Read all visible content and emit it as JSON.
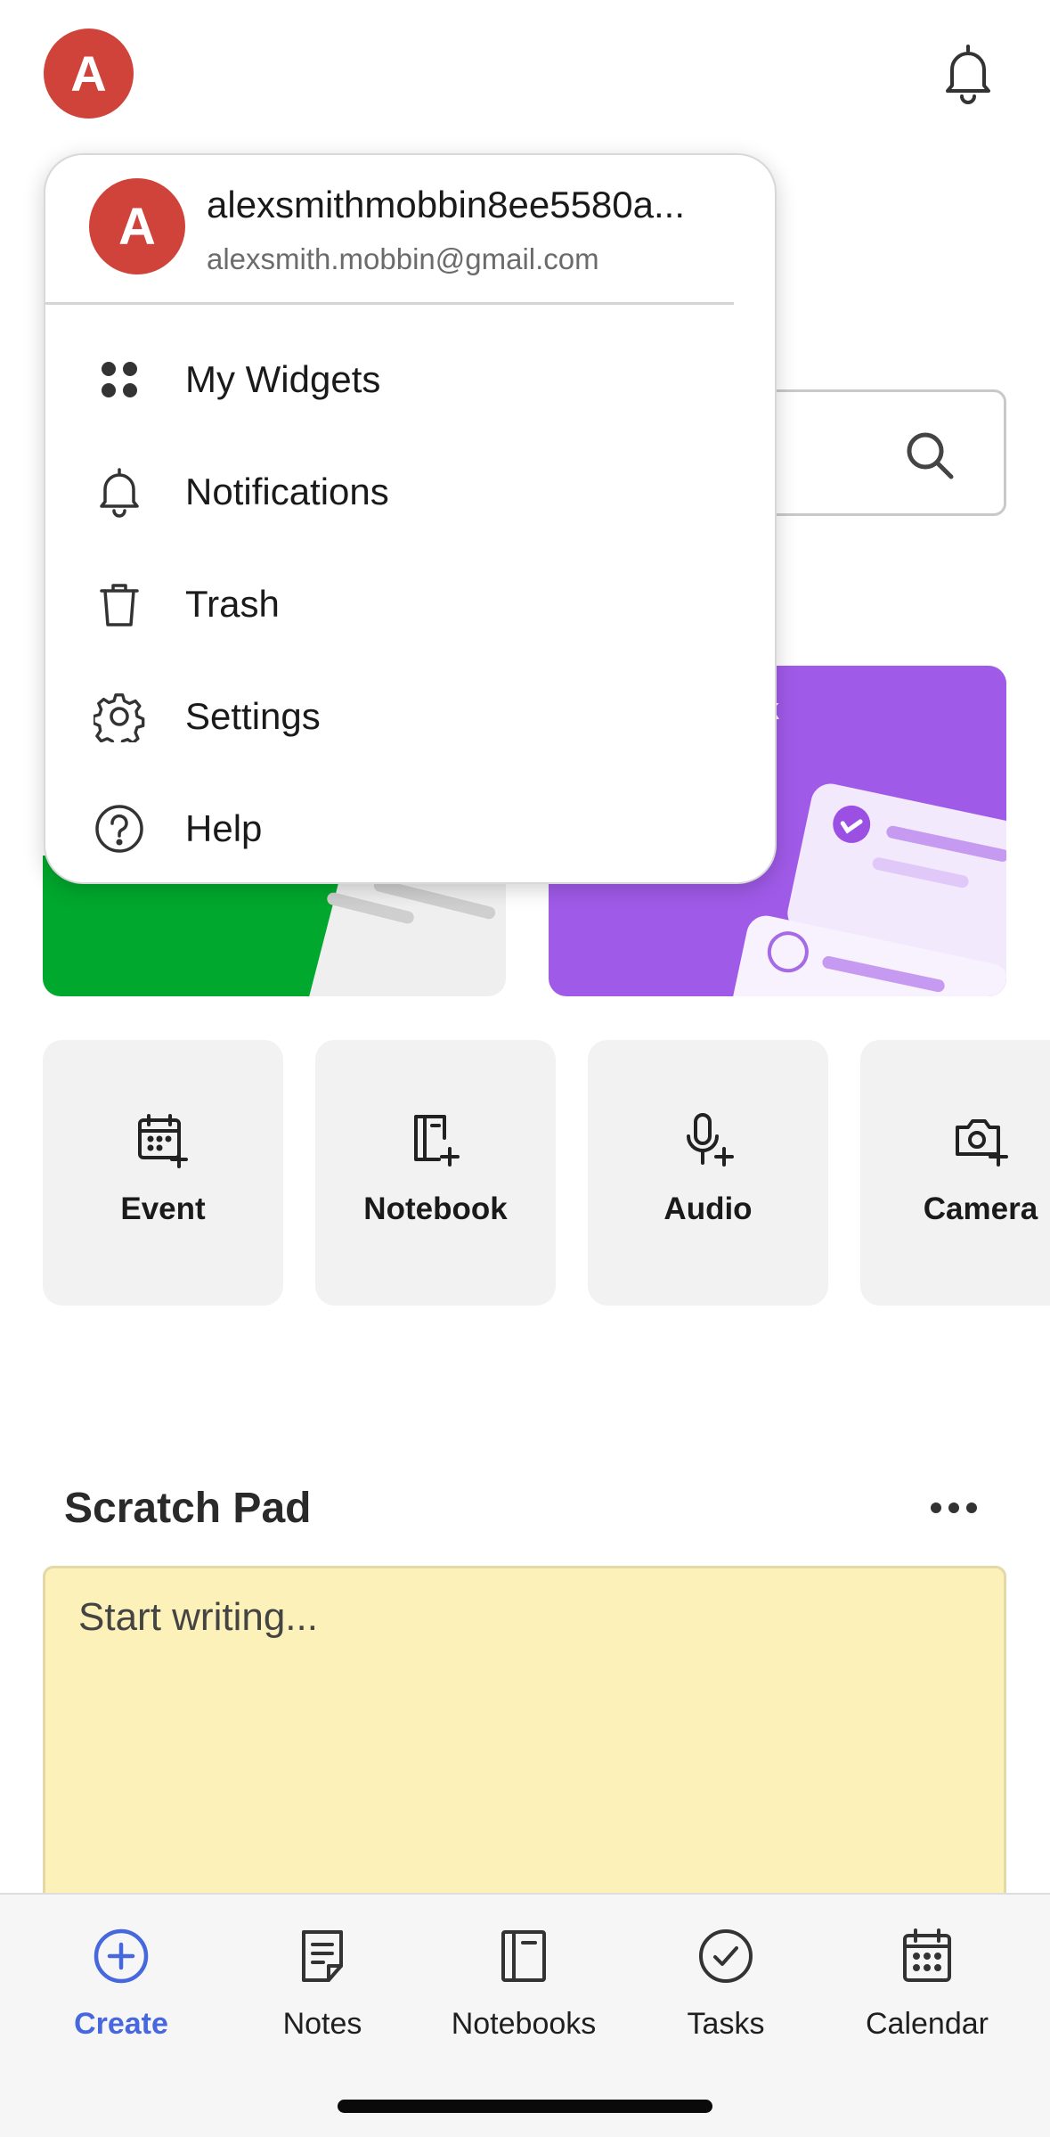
{
  "header": {
    "avatar_letter": "A",
    "notification_icon": "bell-icon"
  },
  "account_menu": {
    "avatar_letter": "A",
    "username": "alexsmithmobbin8ee5580a...",
    "email": "alexsmith.mobbin@gmail.com",
    "items": [
      {
        "label": "My Widgets",
        "icon": "widgets-icon"
      },
      {
        "label": "Notifications",
        "icon": "bell-icon"
      },
      {
        "label": "Trash",
        "icon": "trash-icon"
      },
      {
        "label": "Settings",
        "icon": "gear-icon"
      },
      {
        "label": "Help",
        "icon": "help-circle-icon"
      }
    ]
  },
  "search": {
    "icon": "search-icon"
  },
  "promo": {
    "purple_card_partial_text": "k",
    "colors": {
      "green": "#00a82d",
      "purple": "#a05ae8"
    }
  },
  "quick_actions": [
    {
      "label": "Event",
      "icon": "calendar-plus-icon"
    },
    {
      "label": "Notebook",
      "icon": "notebook-plus-icon"
    },
    {
      "label": "Audio",
      "icon": "mic-plus-icon"
    },
    {
      "label": "Camera",
      "icon": "camera-plus-icon"
    }
  ],
  "scratch_pad": {
    "title": "Scratch Pad",
    "placeholder": "Start writing...",
    "more_icon": "more-horizontal-icon"
  },
  "bottom_nav": [
    {
      "label": "Create",
      "icon": "plus-circle-icon",
      "active": true
    },
    {
      "label": "Notes",
      "icon": "note-icon",
      "active": false
    },
    {
      "label": "Notebooks",
      "icon": "notebook-icon",
      "active": false
    },
    {
      "label": "Tasks",
      "icon": "check-circle-icon",
      "active": false
    },
    {
      "label": "Calendar",
      "icon": "calendar-icon",
      "active": false
    }
  ],
  "accent_color": "#4667de"
}
